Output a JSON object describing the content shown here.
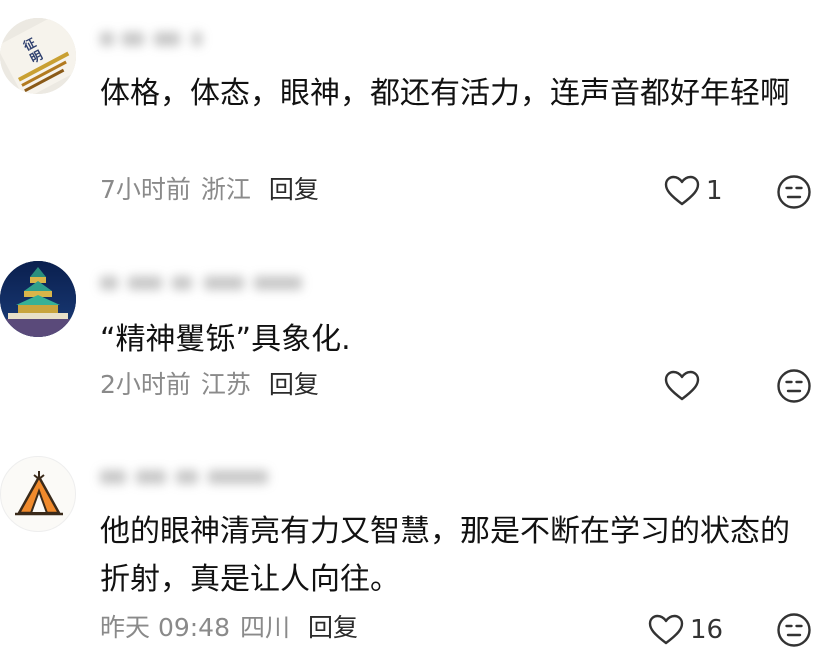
{
  "comments": [
    {
      "username_blurred": true,
      "text": "体格，体态，眼神，都还有活力，连声音都好年轻啊",
      "time": "7小时前",
      "location": "浙江",
      "reply_label": "回复",
      "likes": "1",
      "avatar_icon": "book-cover-avatar"
    },
    {
      "username_blurred": true,
      "text": "“精神矍铄”具象化.",
      "time": "2小时前",
      "location": "江苏",
      "reply_label": "回复",
      "likes": "",
      "avatar_icon": "temple-of-heaven-avatar"
    },
    {
      "username_blurred": true,
      "text": "他的眼神清亮有力又智慧，那是不断在学习的状态的折射，真是让人向往。",
      "time": "昨天 09:48",
      "location": "四川",
      "reply_label": "回复",
      "likes": "16",
      "avatar_icon": "tent-avatar"
    }
  ],
  "icons": {
    "like": "heart-outline-icon",
    "reaction": "neutral-face-icon"
  },
  "colors": {
    "text": "#111111",
    "meta": "#8a8a8a",
    "tent_orange": "#f08a2c"
  }
}
